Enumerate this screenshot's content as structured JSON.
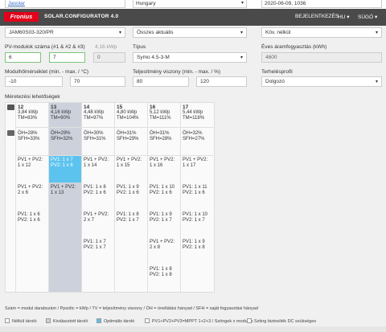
{
  "top": {
    "field1": "Jasolar",
    "field2": "Hungary",
    "field3": "2020-06-09, 1036"
  },
  "header": {
    "logo": "Fronius",
    "title": "SOLAR.CONFIGURATOR 4.0",
    "login": "BEJELENTKEZÉS",
    "lang": "HU ▾",
    "help": "SÚGÓ ▾"
  },
  "product": {
    "module": "JAM60S03-320/PR",
    "filter": "Összes aktuális",
    "cooling": "Köv. nélkül"
  },
  "pv": {
    "label": "PV-modulok száma (#1 & #2 & #3)",
    "power": "4,16 kWp",
    "v1": "6",
    "v2": "7",
    "v3": "0"
  },
  "type": {
    "label": "Típus",
    "value": "Symo 4.5-3-M"
  },
  "consumption": {
    "label": "Éves áramfogyasztás (kWh)",
    "value": "4600"
  },
  "temp": {
    "label": "Modulhőmérséklet (min. - max. / °C)",
    "min": "-10",
    "max": "70"
  },
  "perf": {
    "label": "Teljesítmény viszony (min. - max. / %)",
    "min": "80",
    "max": "120"
  },
  "profile": {
    "label": "Terhelésprofil",
    "value": "Dolgozó"
  },
  "grid": {
    "title": "Méretezési lehetőségek",
    "columns": [
      {
        "num": "12",
        "kwp": "3,84 kWp",
        "tm": "TM=83%",
        "oh": "ÖH=28%",
        "sfh": "SFH=33%"
      },
      {
        "num": "13",
        "kwp": "4,16 kWp",
        "tm": "TM=90%",
        "oh": "ÖH=29%",
        "sfh": "SFH=32%"
      },
      {
        "num": "14",
        "kwp": "4,48 kWp",
        "tm": "TM=97%",
        "oh": "ÖH=30%",
        "sfh": "SFH=31%"
      },
      {
        "num": "15",
        "kwp": "4,80 kWp",
        "tm": "TM=104%",
        "oh": "ÖH=31%",
        "sfh": "SFH=29%"
      },
      {
        "num": "16",
        "kwp": "5,12 kWp",
        "tm": "TM=111%",
        "oh": "ÖH=31%",
        "sfh": "SFH=28%"
      },
      {
        "num": "17",
        "kwp": "5,44 kWp",
        "tm": "TM=118%",
        "oh": "ÖH=32%",
        "sfh": "SFH=27%"
      }
    ],
    "cells": [
      [
        [
          "PV1 + PV2:",
          "1 x 12"
        ],
        [
          "PV1 + PV2:",
          "2 x 6"
        ],
        [
          "PV1: 1 x 6",
          "PV2: 1 x 6"
        ],
        null,
        null,
        null
      ],
      [
        [
          "PV1: 1 x 7",
          "PV2: 1 x 6"
        ],
        [
          "PV1 + PV2:",
          "1 x 13"
        ],
        null,
        null,
        null,
        null
      ],
      [
        [
          "PV1 + PV2:",
          "1 x 14"
        ],
        [
          "PV1: 1 x 8",
          "PV2: 1 x 6"
        ],
        [
          "PV1 + PV2:",
          "2 x 7"
        ],
        [
          "PV1: 1 x 7",
          "PV2: 1 x 7"
        ],
        null,
        null
      ],
      [
        [
          "PV1 + PV2:",
          "1 x 15"
        ],
        [
          "PV1: 1 x 9",
          "PV2: 1 x 6"
        ],
        [
          "PV1: 1 x 8",
          "PV2: 1 x 7"
        ],
        null,
        null,
        null
      ],
      [
        [
          "PV1 + PV2:",
          "1 x 16"
        ],
        [
          "PV1: 1 x 10",
          "PV2: 1 x 6"
        ],
        [
          "PV1: 1 x 9",
          "PV2: 1 x 7"
        ],
        [
          "PV1 + PV2:",
          "2 x 8"
        ],
        [
          "PV1: 1 x 8",
          "PV2: 1 x 8"
        ],
        null
      ],
      [
        [
          "PV1 + PV2:",
          "1 x 17"
        ],
        [
          "PV1: 1 x 11",
          "PV2: 1 x 6"
        ],
        [
          "PV1: 1 x 10",
          "PV2: 1 x 7"
        ],
        [
          "PV1: 1 x 9",
          "PV2: 1 x 8"
        ],
        null,
        null
      ]
    ]
  },
  "legend": {
    "line1": "Szám = modul darabszám / Ppsoltc = kWp / TV = teljesítmény viszony / ÖH = önellátási hányad / SFH = saját fogyasztási hányad",
    "items": [
      "Nélkül tároló",
      "Kiválasztott tároló",
      "Optimális tároló",
      "PV1+PV2+PV3=MPPT 1+2+3 / Szöngek x modulok",
      "Szting biztosíték DC szüksèges"
    ],
    "colors": [
      "#ffffff",
      "#cdd1dc",
      "#5cc3ef",
      "#ffffff",
      "#ffffff"
    ]
  }
}
